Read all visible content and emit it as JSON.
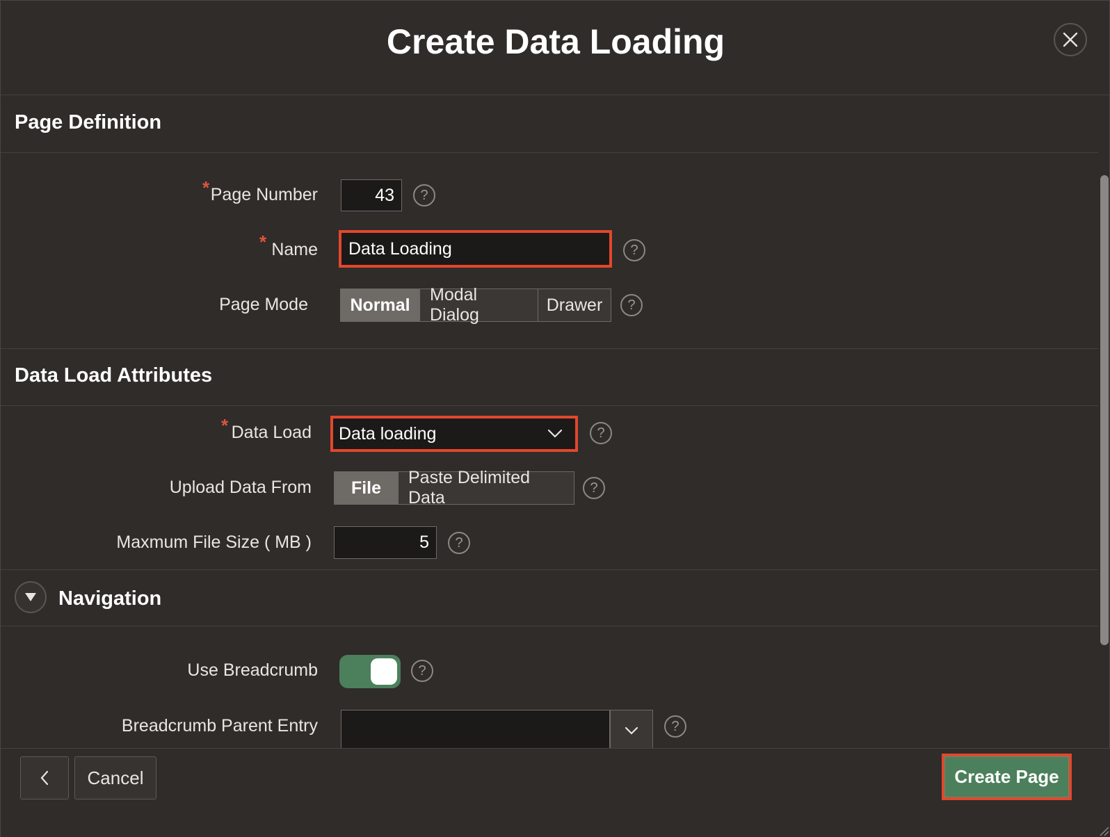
{
  "dialog": {
    "title": "Create Data Loading"
  },
  "page_definition": {
    "title": "Page Definition",
    "page_number": {
      "label": "Page Number",
      "value": "43",
      "required": true
    },
    "name": {
      "label": "Name",
      "value": "Data Loading",
      "required": true
    },
    "page_mode": {
      "label": "Page Mode",
      "options": [
        "Normal",
        "Modal Dialog",
        "Drawer"
      ],
      "selected": "Normal"
    }
  },
  "data_load_attributes": {
    "title": "Data Load Attributes",
    "data_load": {
      "label": "Data Load",
      "value": "Data loading",
      "required": true
    },
    "upload_from": {
      "label": "Upload Data From",
      "options": [
        "File",
        "Paste Delimited Data"
      ],
      "selected": "File"
    },
    "max_file_size": {
      "label": "Maxmum File Size ( MB )",
      "value": "5"
    }
  },
  "navigation": {
    "title": "Navigation",
    "use_breadcrumb": {
      "label": "Use Breadcrumb",
      "on": true
    },
    "breadcrumb_parent": {
      "label": "Breadcrumb Parent Entry",
      "value": ""
    }
  },
  "footer": {
    "cancel_label": "Cancel",
    "create_label": "Create Page"
  },
  "help_glyph": "?",
  "colors": {
    "background": "#2f2c2a",
    "accent_green": "#4c7f5b",
    "highlight_red": "#e2472d",
    "required_star": "#e0543d"
  }
}
